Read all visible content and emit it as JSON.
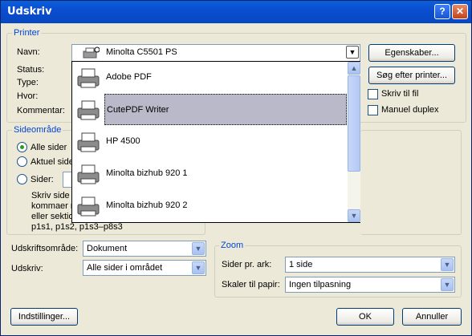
{
  "window": {
    "title": "Udskriv",
    "help_glyph": "?",
    "close_glyph": "✕"
  },
  "printer": {
    "group_label": "Printer",
    "name_label": "Navn:",
    "status_label": "Status:",
    "type_label": "Type:",
    "where_label": "Hvor:",
    "comment_label": "Kommentar:",
    "selected_printer": "Minolta C5501 PS",
    "properties_button": "Egenskaber...",
    "find_printer_button": "Søg efter printer...",
    "print_to_file_label": "Skriv til fil",
    "manual_duplex_label": "Manuel duplex",
    "print_to_file_checked": false,
    "manual_duplex_checked": false
  },
  "printer_dropdown": {
    "items": [
      {
        "label": "Adobe PDF",
        "selected": false
      },
      {
        "label": "CutePDF Writer",
        "selected": true
      },
      {
        "label": "HP 4500",
        "selected": false
      },
      {
        "label": "Minolta bizhub 920 1",
        "selected": false
      },
      {
        "label": "Minolta bizhub 920 2",
        "selected": false
      }
    ]
  },
  "page_range": {
    "group_label": "Sideområde",
    "all_pages_label": "Alle sider",
    "current_page_label": "Aktuel side",
    "pages_label": "Sider:",
    "selected_option": "all",
    "help_line1": "Skriv side",
    "help_line2": "kommaer m",
    "help_line3": "eller sektio",
    "help_line4": "p1s1, p1s2, p1s3–p8s3"
  },
  "print_what": {
    "label": "Udskriftsområde:",
    "value": "Dokument"
  },
  "print": {
    "label": "Udskriv:",
    "value": "Alle sider i området"
  },
  "zoom": {
    "group_label": "Zoom",
    "pages_per_sheet_label": "Sider pr. ark:",
    "pages_per_sheet_value": "1 side",
    "scale_label": "Skaler til papir:",
    "scale_value": "Ingen tilpasning"
  },
  "footer": {
    "options_button": "Indstillinger...",
    "ok_button": "OK",
    "cancel_button": "Annuller"
  }
}
